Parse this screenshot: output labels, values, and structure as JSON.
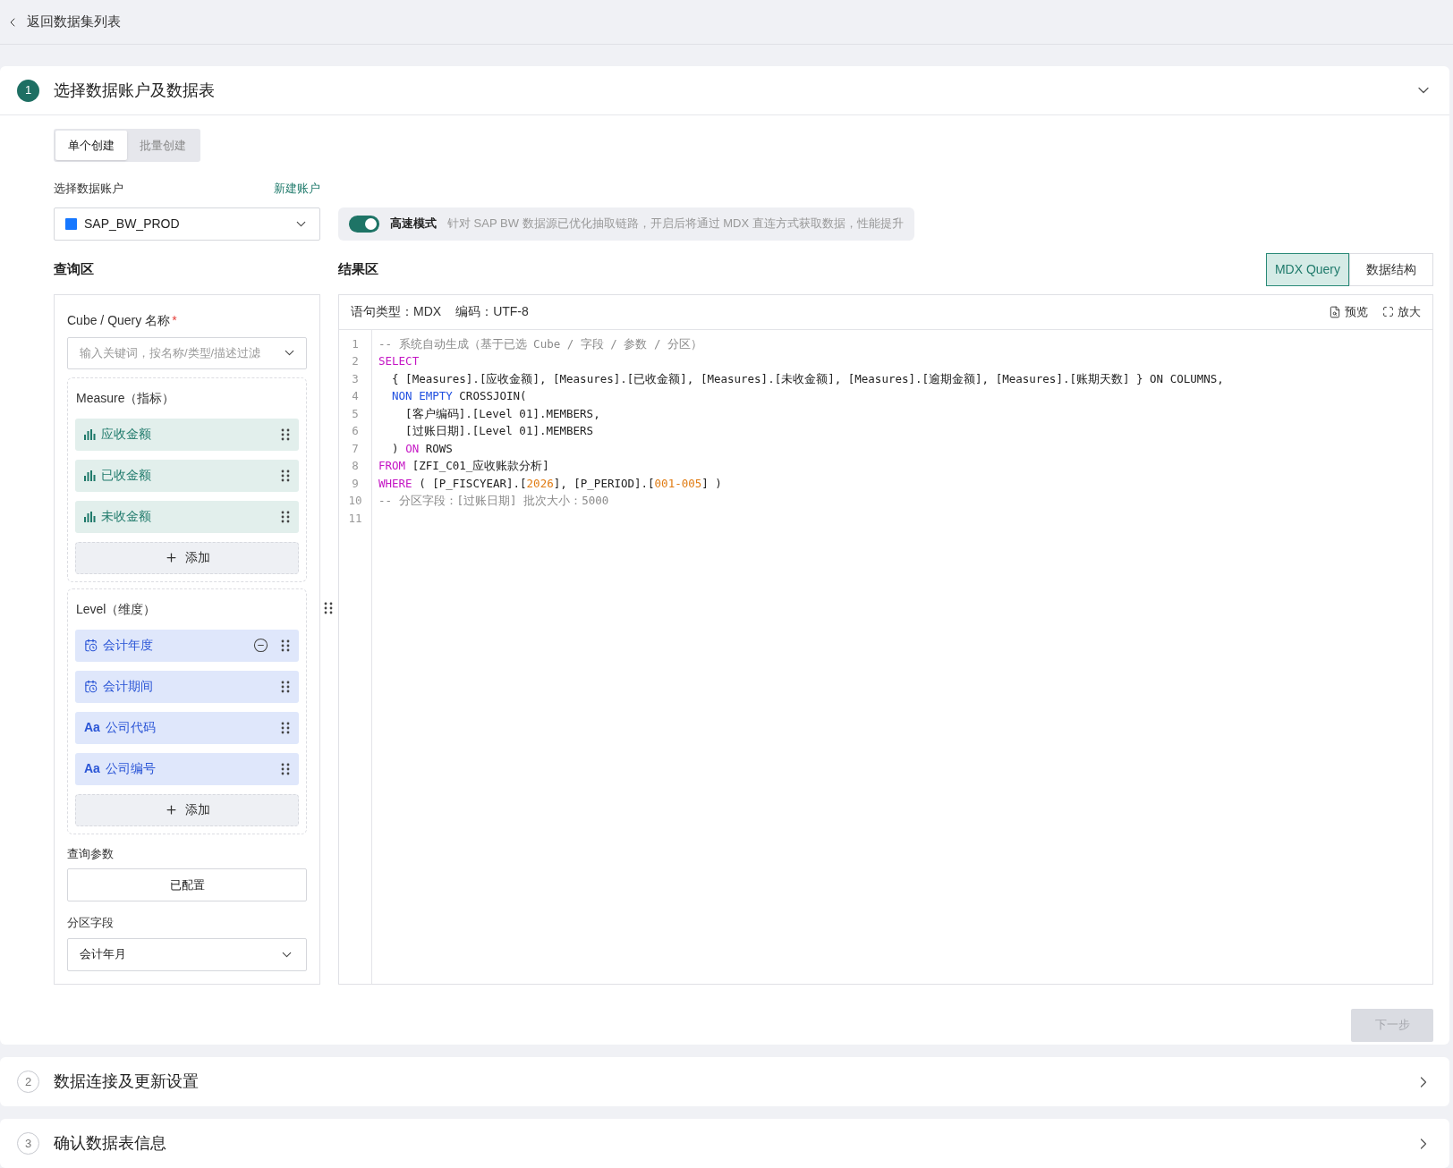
{
  "back_link": {
    "label": "返回数据集列表"
  },
  "steps": [
    {
      "number": "1",
      "title": "选择数据账户及数据表",
      "expanded": true
    },
    {
      "number": "2",
      "title": "数据连接及更新设置",
      "expanded": false
    },
    {
      "number": "3",
      "title": "确认数据表信息",
      "expanded": false
    }
  ],
  "create_modes": [
    {
      "label": "单个创建",
      "selected": true
    },
    {
      "label": "批量创建",
      "selected": false
    }
  ],
  "account": {
    "label": "选择数据账户",
    "new_link": "新建账户",
    "value": "SAP_BW_PROD",
    "color": "#1677ff"
  },
  "fast_mode": {
    "on": true,
    "label": "高速模式",
    "description": "针对 SAP BW 数据源已优化抽取链路，开启后将通过 MDX 直连方式获取数据，性能提升"
  },
  "query_area": {
    "title": "查询区",
    "cube_label": "Cube / Query 名称",
    "required_mark": "*",
    "cube_placeholder": "输入关键词，按名称/类型/描述过滤",
    "measure_group": {
      "title": "Measure（指标）",
      "add_label": "添加",
      "items": [
        {
          "kind": "measure",
          "label": "应收金额",
          "removable": false
        },
        {
          "kind": "measure",
          "label": "已收金额",
          "removable": false
        },
        {
          "kind": "measure",
          "label": "未收金额",
          "removable": false
        }
      ]
    },
    "level_group": {
      "title": "Level（维度）",
      "add_label": "添加",
      "items": [
        {
          "kind": "date",
          "label": "会计年度",
          "removable": true
        },
        {
          "kind": "date",
          "label": "会计期间",
          "removable": false
        },
        {
          "kind": "text",
          "glyph": "Aa",
          "label": "公司代码",
          "removable": false
        },
        {
          "kind": "text",
          "glyph": "Aa",
          "label": "公司编号",
          "removable": false
        }
      ]
    },
    "params_label": "查询参数",
    "params_button": "已配置",
    "partition_label": "分区字段",
    "partition_value": "会计年月"
  },
  "result_area": {
    "title": "结果区",
    "view_tabs": [
      {
        "label": "MDX Query",
        "selected": true
      },
      {
        "label": "数据结构",
        "selected": false
      }
    ],
    "statement_type": "语句类型：MDX",
    "encoding": "编码：UTF-8",
    "actions": [
      {
        "kind": "preview",
        "label": "预览"
      },
      {
        "kind": "expand",
        "label": "放大"
      }
    ],
    "code_lines": [
      {
        "number": "1",
        "tokens": [
          {
            "kind": "comment",
            "text": "-- 系统自动生成（基于已选 Cube / 字段 / 参数 / 分区）"
          }
        ]
      },
      {
        "number": "2",
        "tokens": [
          {
            "kind": "keyword",
            "text": "SELECT"
          }
        ]
      },
      {
        "number": "3",
        "tokens": [
          {
            "kind": "plain",
            "text": "  { [Measures].[应收金额], [Measures].[已收金额], [Measures].[未收金额], [Measures].[逾期金额], [Measures].[账期天数] } ON COLUMNS,"
          }
        ]
      },
      {
        "number": "4",
        "tokens": [
          {
            "kind": "function",
            "text": "  NON EMPTY"
          },
          {
            "kind": "plain",
            "text": " CROSSJOIN("
          }
        ]
      },
      {
        "number": "5",
        "tokens": [
          {
            "kind": "plain",
            "text": "    [客户编码].[Level 01].MEMBERS,"
          }
        ]
      },
      {
        "number": "6",
        "tokens": [
          {
            "kind": "plain",
            "text": "    [过账日期].[Level 01].MEMBERS"
          }
        ]
      },
      {
        "number": "7",
        "tokens": [
          {
            "kind": "plain",
            "text": "  ) "
          },
          {
            "kind": "keyword",
            "text": "ON"
          },
          {
            "kind": "plain",
            "text": " ROWS"
          }
        ]
      },
      {
        "number": "8",
        "tokens": [
          {
            "kind": "keyword",
            "text": "FROM"
          },
          {
            "kind": "plain",
            "text": " [ZFI_C01_应收账款分析]"
          }
        ]
      },
      {
        "number": "9",
        "tokens": [
          {
            "kind": "keyword",
            "text": "WHERE"
          },
          {
            "kind": "plain",
            "text": " ( [P_FISCYEAR].["
          },
          {
            "kind": "number",
            "text": "2026"
          },
          {
            "kind": "plain",
            "text": "], [P_PERIOD].["
          },
          {
            "kind": "number",
            "text": "001-005"
          },
          {
            "kind": "plain",
            "text": "] )"
          }
        ]
      },
      {
        "number": "10",
        "tokens": [
          {
            "kind": "comment",
            "text": "-- 分区字段：[过账日期] 批次大小：5000"
          }
        ]
      },
      {
        "number": "11"
      }
    ]
  },
  "next_button": {
    "label": "下一步",
    "disabled": true
  }
}
